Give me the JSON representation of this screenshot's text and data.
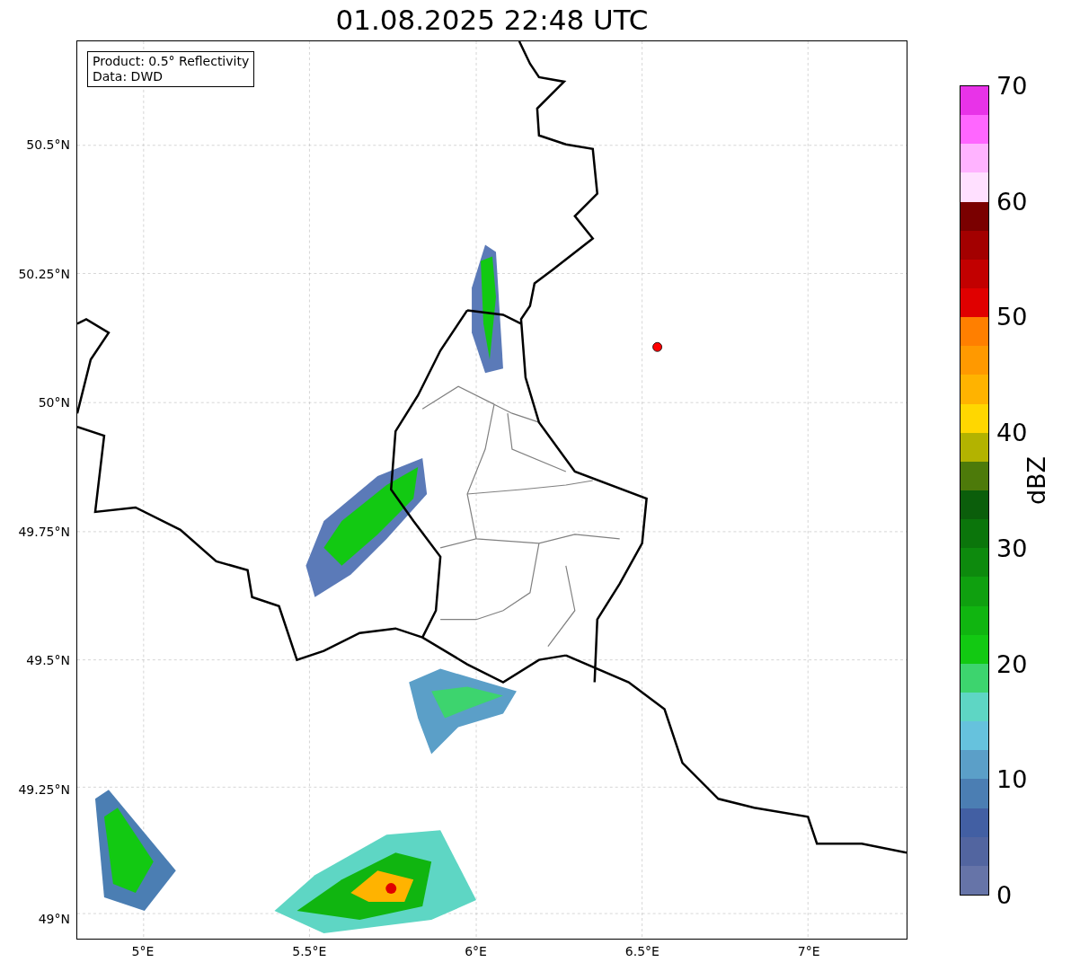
{
  "title": "01.08.2025 22:48 UTC",
  "info_box": [
    "Product: 0.5° Reflectivity",
    "Data: DWD"
  ],
  "lat_ticks": [
    "50.5°N",
    "50.25°N",
    "50°N",
    "49.75°N",
    "49.5°N",
    "49.25°N",
    "49°N"
  ],
  "lon_ticks": [
    "5°E",
    "5.5°E",
    "6°E",
    "6.5°E",
    "7°E"
  ],
  "colorbar": {
    "label": "dBZ",
    "ticks": [
      "70",
      "60",
      "50",
      "40",
      "30",
      "20",
      "10",
      "0"
    ],
    "bins": [
      {
        "color": "#6674a8"
      },
      {
        "color": "#5265a0"
      },
      {
        "color": "#425fa3"
      },
      {
        "color": "#4b7eb3"
      },
      {
        "color": "#5b9fc8"
      },
      {
        "color": "#66c2dd"
      },
      {
        "color": "#5ed6c4"
      },
      {
        "color": "#3dd46e"
      },
      {
        "color": "#12c912"
      },
      {
        "color": "#10b510"
      },
      {
        "color": "#0fa00f"
      },
      {
        "color": "#0d8a0d"
      },
      {
        "color": "#0b750b"
      },
      {
        "color": "#0b5e0b"
      },
      {
        "color": "#4d7a0a"
      },
      {
        "color": "#b3b300"
      },
      {
        "color": "#ffd700"
      },
      {
        "color": "#ffb300"
      },
      {
        "color": "#ff9900"
      },
      {
        "color": "#ff7f00"
      },
      {
        "color": "#e00000"
      },
      {
        "color": "#c20000"
      },
      {
        "color": "#a30000"
      },
      {
        "color": "#7a0000"
      },
      {
        "color": "#ffe0ff"
      },
      {
        "color": "#ffb3ff"
      },
      {
        "color": "#ff66ff"
      },
      {
        "color": "#e833e8"
      }
    ]
  }
}
